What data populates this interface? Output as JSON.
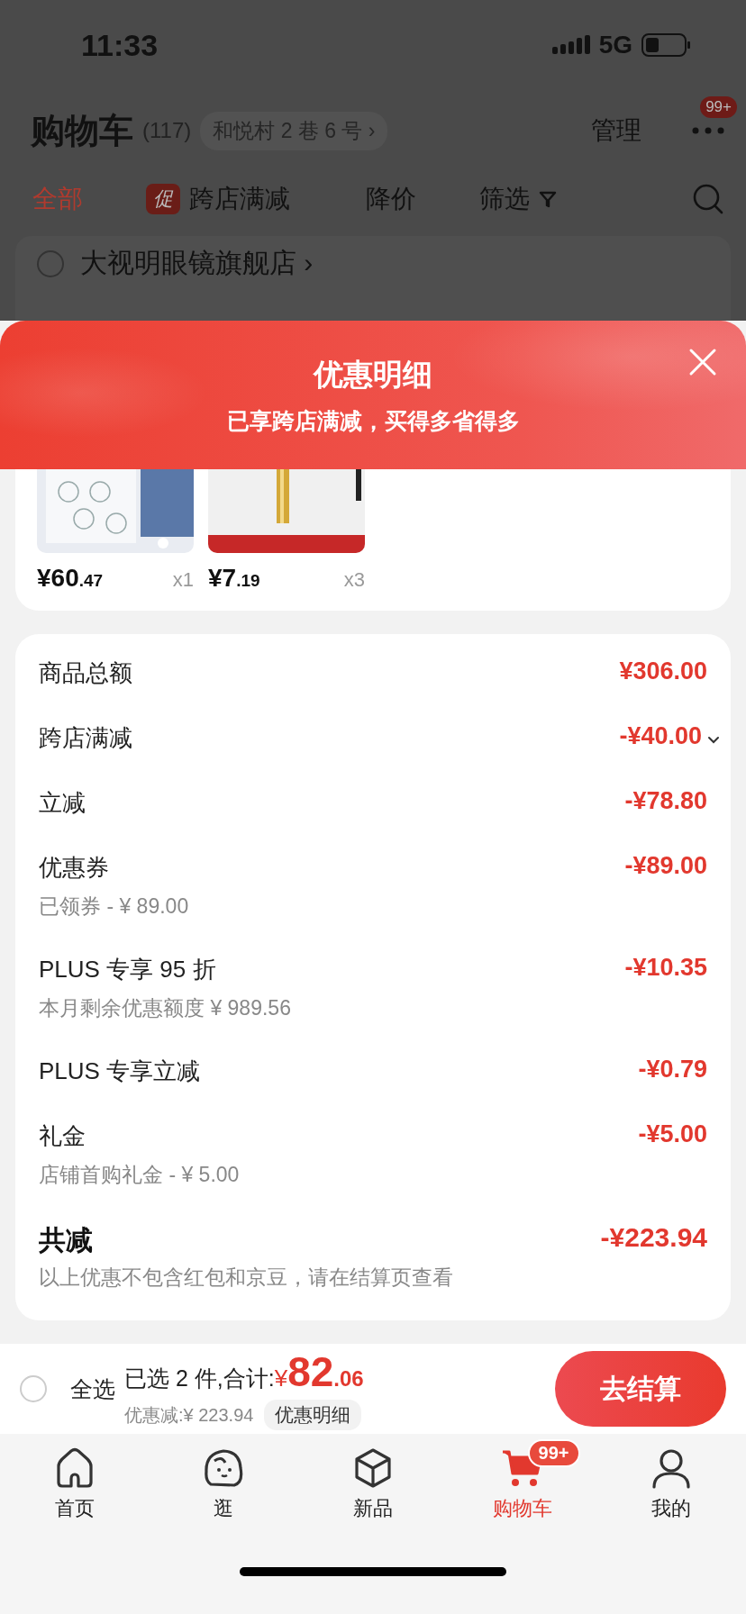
{
  "status_bar": {
    "time": "11:33",
    "network": "5G"
  },
  "header": {
    "title": "购物车",
    "count": "(117)",
    "address": "和悦村 2 巷 6 号 ›",
    "manage": "管理",
    "more_badge": "99+"
  },
  "filter_tabs": [
    {
      "label": "全部",
      "selected": true
    },
    {
      "label": "跨店满减",
      "selected": false,
      "tag": "促"
    },
    {
      "label": "降价",
      "selected": false
    },
    {
      "label": "筛选",
      "selected": false,
      "kind": "filter"
    }
  ],
  "store": {
    "name": "大视明眼镜旗舰店 ›",
    "checked": false
  },
  "sheet": {
    "title": "优惠明细",
    "subtitle": "已享跨店满减，买得多省得多"
  },
  "products": [
    {
      "kind": "picture",
      "price": "¥60",
      "price_cents": ".47",
      "quantity": "x1"
    },
    {
      "kind": "picture",
      "price": "¥7",
      "price_cents": ".19",
      "quantity": "x3"
    }
  ],
  "details": [
    {
      "kind": "line",
      "label": "商品总额",
      "amount": "¥306.00"
    },
    {
      "kind": "expandable",
      "label": "跨店满减",
      "amount": "-¥40.00",
      "expanded": false
    },
    {
      "kind": "line",
      "label": "立减",
      "amount": "-¥78.80"
    },
    {
      "kind": "line",
      "label": "优惠券",
      "amount": "-¥89.00",
      "note": "已领券 - ¥ 89.00"
    },
    {
      "kind": "line",
      "label": "PLUS 专享 95 折",
      "amount": "-¥10.35",
      "note": "本月剩余优惠额度  ¥ 989.56"
    },
    {
      "kind": "line",
      "label": "PLUS 专享立减",
      "amount": "-¥0.79"
    },
    {
      "kind": "line",
      "label": "礼金",
      "amount": "-¥5.00",
      "note": "店铺首购礼金 - ¥ 5.00"
    },
    {
      "kind": "total",
      "label": "共减",
      "amount": "-¥223.94"
    }
  ],
  "details_note": "以上优惠不包含红包和京豆，请在结算页查看",
  "checkout": {
    "select_all": "全选",
    "checked": false,
    "summary": "已选 2 件,合计:",
    "currency": "¥",
    "total": "82",
    "total_cents": ".06",
    "discount": "优惠减:¥ 223.94",
    "details_button": "优惠明细",
    "button": "去结算"
  },
  "bottom_nav": [
    {
      "label": "首页",
      "selected": false
    },
    {
      "label": "逛",
      "selected": false
    },
    {
      "label": "新品",
      "selected": false
    },
    {
      "label": "购物车",
      "selected": true,
      "badge": "99+"
    },
    {
      "label": "我的",
      "selected": false
    }
  ]
}
